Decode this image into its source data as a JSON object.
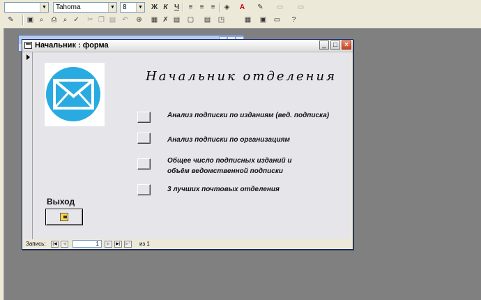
{
  "toolbar": {
    "object_combo": "",
    "font_name": "Tahoma",
    "font_size": "8",
    "bold": "Ж",
    "italic": "К",
    "underline": "Ч",
    "font_color": "A"
  },
  "window": {
    "title": "Начальник : форма",
    "minimize": "_",
    "maximize": "□",
    "close": "×"
  },
  "form": {
    "heading": "Начальник отделения",
    "buttons": [
      {
        "label": "Анализ подписки по изданиям (вед. подписка)"
      },
      {
        "label": "Анализ подписки по организациям"
      },
      {
        "label_line1": "Общее число подписных изданий и",
        "label_line2": "объём ведомственной подписки"
      },
      {
        "label": "3 лучших почтовых отделения"
      }
    ],
    "exit_label": "Выход"
  },
  "navigation": {
    "record_label": "Запись:",
    "current_record": "1",
    "of_text": "из 1"
  },
  "colors": {
    "logo_circle": "#29abe2",
    "title_close": "#d9532c"
  }
}
